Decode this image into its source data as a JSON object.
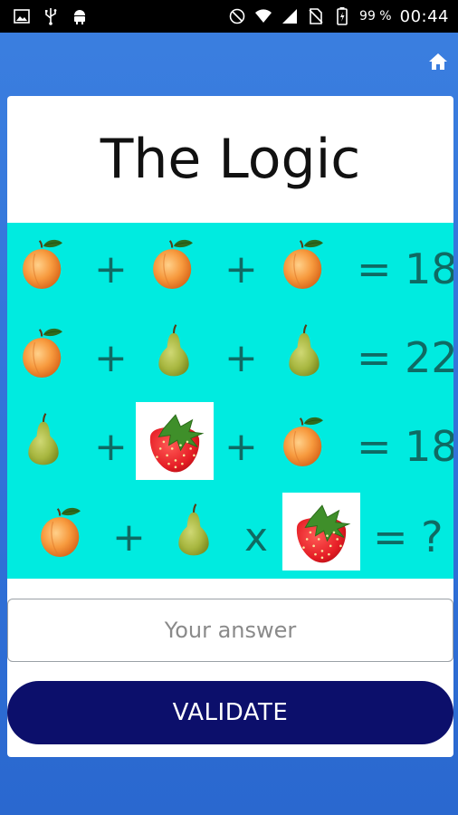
{
  "status_bar": {
    "battery_percent": "99 %",
    "time": "00:44",
    "icons": [
      "image-icon",
      "usb-icon",
      "android-icon",
      "dnd-icon",
      "wifi-icon",
      "signal-icon",
      "no-sim-icon",
      "battery-charging-icon"
    ]
  },
  "app_bar": {
    "home_icon": "home-icon"
  },
  "title": "The Logic",
  "puzzle": {
    "rows": [
      {
        "items": [
          "apricot",
          "apricot",
          "apricot"
        ],
        "operators": [
          "+",
          "+"
        ],
        "result": "= 18"
      },
      {
        "items": [
          "apricot",
          "pear",
          "pear"
        ],
        "operators": [
          "+",
          "+"
        ],
        "result": "= 22"
      },
      {
        "items": [
          "pear",
          "strawberry",
          "apricot"
        ],
        "operators": [
          "+",
          "+"
        ],
        "result": "= 18"
      },
      {
        "items": [
          "apricot",
          "pear",
          "strawberry"
        ],
        "operators": [
          "+",
          "x"
        ],
        "result": "= ?"
      }
    ]
  },
  "answer": {
    "placeholder": "Your answer",
    "value": ""
  },
  "validate_label": "VALIDATE",
  "colors": {
    "background": "#3b7fe0",
    "puzzle_bg": "#00ebe0",
    "operator_text": "#0f6a63",
    "button_bg": "#0c0f6b"
  }
}
